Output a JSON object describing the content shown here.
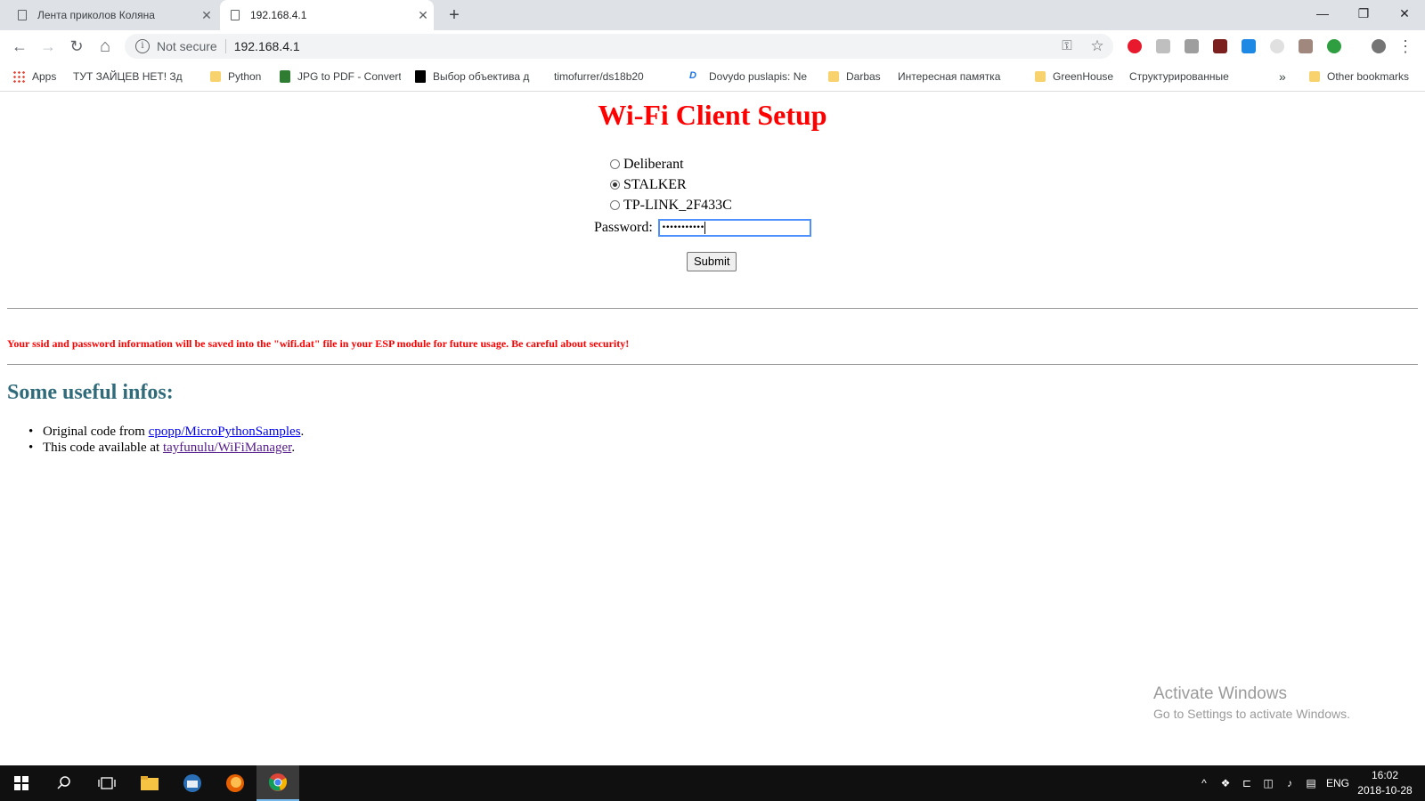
{
  "browser": {
    "tabs": [
      {
        "title": "Лента приколов Коляна",
        "active": false
      },
      {
        "title": "192.168.4.1",
        "active": true
      }
    ],
    "new_tab": "+",
    "window_controls": {
      "minimize": "—",
      "restore": "❐",
      "close": "✕"
    },
    "nav": {
      "back": "←",
      "forward": "→",
      "reload": "↻",
      "home": "⌂"
    },
    "omnibox": {
      "security_label": "Not secure",
      "url": "192.168.4.1"
    },
    "omnibox_icons": {
      "key": "⚿",
      "star": "☆"
    },
    "menu": "⋮",
    "extension_colors": [
      "#e8192c",
      "#bfbfbf",
      "#9e9e9e",
      "#7b1f1f",
      "#1e88e5",
      "#e0e0e0",
      "#a1887f",
      "#2e9e41",
      "#757575"
    ],
    "bookmarks": [
      {
        "label": "Apps",
        "icon": "apps-icon"
      },
      {
        "label": "ТУТ ЗАЙЦЕВ НЕТ! Зд",
        "icon": "page-icon"
      },
      {
        "label": "Python",
        "icon": "folder-icon"
      },
      {
        "label": "JPG to PDF - Convert",
        "icon": "jpg-icon"
      },
      {
        "label": "Выбор объектива д",
        "icon": "black-square-icon"
      },
      {
        "label": "timofurrer/ds18b20",
        "icon": "page-icon"
      },
      {
        "label": "Dovydo puslapis: Ne",
        "icon": "dovydo-icon"
      },
      {
        "label": "Darbas",
        "icon": "folder-icon"
      },
      {
        "label": "Интересная памятка",
        "icon": "page-icon"
      },
      {
        "label": "GreenHouse",
        "icon": "folder-icon"
      },
      {
        "label": "Структурированные",
        "icon": "page-icon"
      }
    ],
    "bookmarks_overflow": "»",
    "other_bookmarks": "Other bookmarks"
  },
  "page": {
    "title": "Wi-Fi Client Setup",
    "networks": [
      {
        "ssid": "Deliberant",
        "selected": false
      },
      {
        "ssid": "STALKER",
        "selected": true
      },
      {
        "ssid": "TP-LINK_2F433C",
        "selected": false
      }
    ],
    "password_label": "Password:",
    "password_mask": "•••••••••••",
    "submit_label": "Submit",
    "warning": "Your ssid and password information will be saved into the \"wifi.dat\" file in your ESP module for future usage. Be careful about security!",
    "infos_heading": "Some useful infos:",
    "infos": [
      {
        "prefix": "Original code from ",
        "link": "cpopp/MicroPythonSamples",
        "suffix": "."
      },
      {
        "prefix": "This code available at ",
        "link": "tayfunulu/WiFiManager",
        "suffix": "."
      }
    ]
  },
  "watermark": {
    "line1": "Activate Windows",
    "line2": "Go to Settings to activate Windows."
  },
  "taskbar": {
    "language": "ENG",
    "time": "16:02",
    "date": "2018-10-28"
  }
}
